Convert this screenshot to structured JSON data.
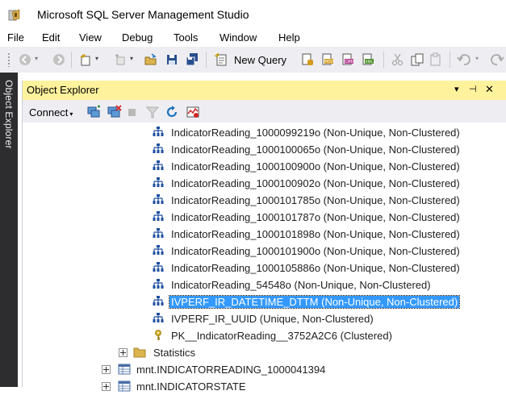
{
  "window": {
    "title": "Microsoft SQL Server Management Studio"
  },
  "menu": [
    "File",
    "Edit",
    "View",
    "Debug",
    "Tools",
    "Window",
    "Help"
  ],
  "toolbar": {
    "new_query_label": "New Query"
  },
  "side_tab": {
    "label": "Object Explorer"
  },
  "object_explorer": {
    "title": "Object Explorer",
    "connect_label": "Connect",
    "header_buttons": [
      "▾",
      "⊣",
      "✕"
    ]
  },
  "tree": {
    "indexes": [
      "IndicatorReading_1000099219o (Non-Unique, Non-Clustered)",
      "IndicatorReading_1000100065o (Non-Unique, Non-Clustered)",
      "IndicatorReading_1000100900o (Non-Unique, Non-Clustered)",
      "IndicatorReading_1000100902o (Non-Unique, Non-Clustered)",
      "IndicatorReading_1000101785o (Non-Unique, Non-Clustered)",
      "IndicatorReading_1000101787o (Non-Unique, Non-Clustered)",
      "IndicatorReading_1000101898o (Non-Unique, Non-Clustered)",
      "IndicatorReading_1000101900o (Non-Unique, Non-Clustered)",
      "IndicatorReading_1000105886o (Non-Unique, Non-Clustered)",
      "IndicatorReading_54548o (Non-Unique, Non-Clustered)",
      "IVPERF_IR_DATETIME_DTTM (Non-Unique, Non-Clustered)",
      "IVPERF_IR_UUID (Unique, Non-Clustered)"
    ],
    "primary_key": "PK__IndicatorReading__3752A2C6 (Clustered)",
    "statistics": "Statistics",
    "tables": [
      "mnt.INDICATORREADING_1000041394",
      "mnt.INDICATORSTATE"
    ],
    "selected_index": 10
  },
  "colors": {
    "header_bg": "#fff29d",
    "selection": "#3399ff",
    "side_tab_bg": "#2d2d30",
    "toolbar_bg": "#eeeef2"
  }
}
